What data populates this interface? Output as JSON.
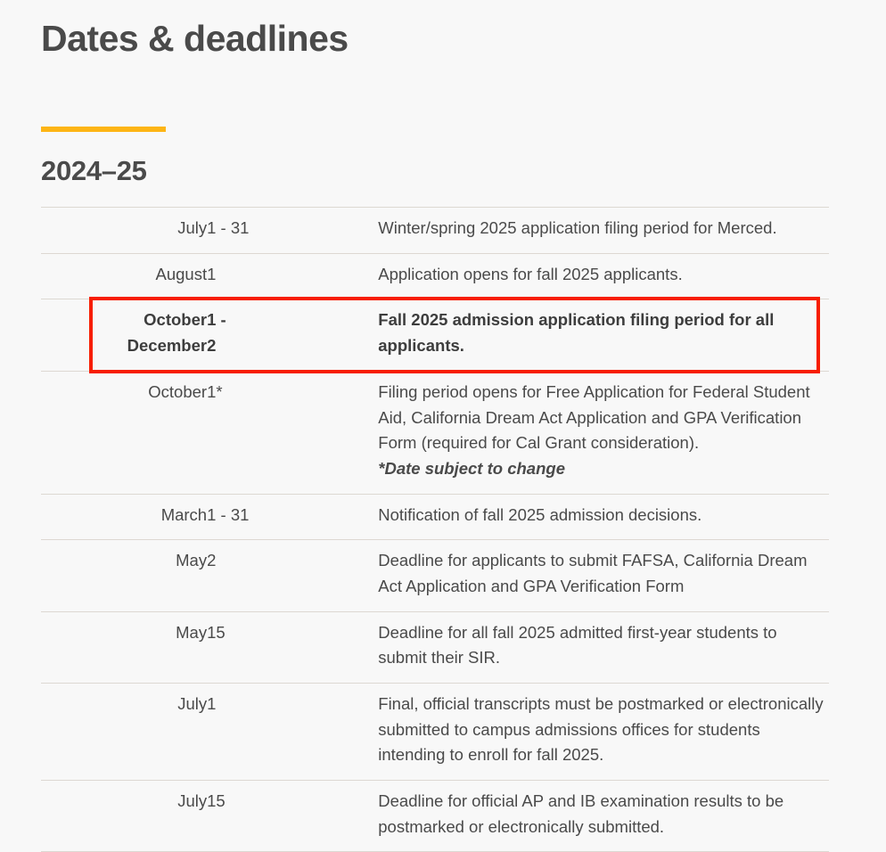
{
  "page": {
    "title": "Dates & deadlines",
    "year_heading": "2024–25",
    "accent_color": "#fdb515",
    "highlight_color": "#f71e00",
    "text_color": "#4a4a4a",
    "background_color": "#f8f8f8"
  },
  "table": {
    "rows": [
      {
        "month": "July",
        "day": "1 - 31",
        "description": "Winter/spring 2025 application filing period for Merced.",
        "note": "",
        "highlighted": false
      },
      {
        "month": "August",
        "day": "1",
        "description": "Application opens for fall 2025 applicants.",
        "note": "",
        "highlighted": false
      },
      {
        "month": "October\nDecember",
        "day": "1 -\n2",
        "description": "Fall 2025 admission application filing period for all applicants.",
        "note": "",
        "highlighted": true
      },
      {
        "month": "October",
        "day": "1*",
        "description": "Filing period opens for Free Application for Federal Student Aid, California Dream Act Application and GPA Verification Form (required for Cal Grant consideration).",
        "note": "*Date subject to change",
        "highlighted": false
      },
      {
        "month": "March",
        "day": "1 - 31",
        "description": "Notification of fall 2025 admission decisions.",
        "note": "",
        "highlighted": false
      },
      {
        "month": "May",
        "day": "2",
        "description": "Deadline for applicants to submit FAFSA, California Dream Act Application and GPA Verification Form",
        "note": "",
        "highlighted": false
      },
      {
        "month": "May",
        "day": "15",
        "description": "Deadline for all fall 2025 admitted first-year students to submit their SIR.",
        "note": "",
        "highlighted": false
      },
      {
        "month": "July",
        "day": "1",
        "description": "Final, official transcripts must be postmarked or electronically submitted to campus admissions offices for students intending to enroll for fall 2025.",
        "note": "",
        "highlighted": false
      },
      {
        "month": "July",
        "day": "15",
        "description": "Deadline for official AP and IB examination results to be postmarked or electronically submitted.",
        "note": "",
        "highlighted": false
      }
    ]
  }
}
